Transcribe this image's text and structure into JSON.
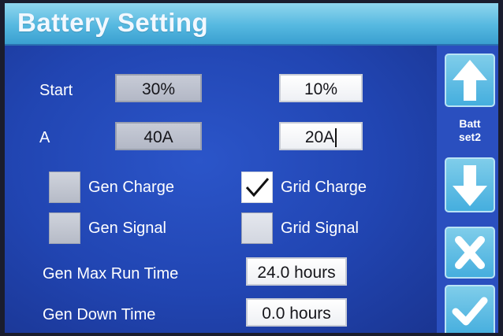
{
  "title": "Battery Setting",
  "rows": {
    "start": {
      "label": "Start",
      "value1": "30%",
      "value2": "10%"
    },
    "amps": {
      "label": "A",
      "value1": "40A",
      "value2": "20A"
    }
  },
  "checkboxes": [
    {
      "label": "Gen Charge",
      "checked": false
    },
    {
      "label": "Grid Charge",
      "checked": true
    },
    {
      "label": "Gen Signal",
      "checked": false
    },
    {
      "label": "Grid Signal",
      "checked": false
    }
  ],
  "gen_max_run_time": {
    "label": "Gen Max Run Time",
    "value": "24.0 hours"
  },
  "gen_down_time": {
    "label": "Gen Down Time",
    "value": "0.0 hours"
  },
  "sidebar": {
    "page_label_line1": "Batt",
    "page_label_line2": "set2"
  },
  "icons": [
    "up-arrow-icon",
    "down-arrow-icon",
    "cancel-x-icon",
    "confirm-check-icon",
    "checkmark-icon"
  ],
  "colors": {
    "screen_bg": "#1f3a8c",
    "title_bar": "#55b8e0",
    "side_button": "#45aede",
    "text": "#ffffff"
  }
}
